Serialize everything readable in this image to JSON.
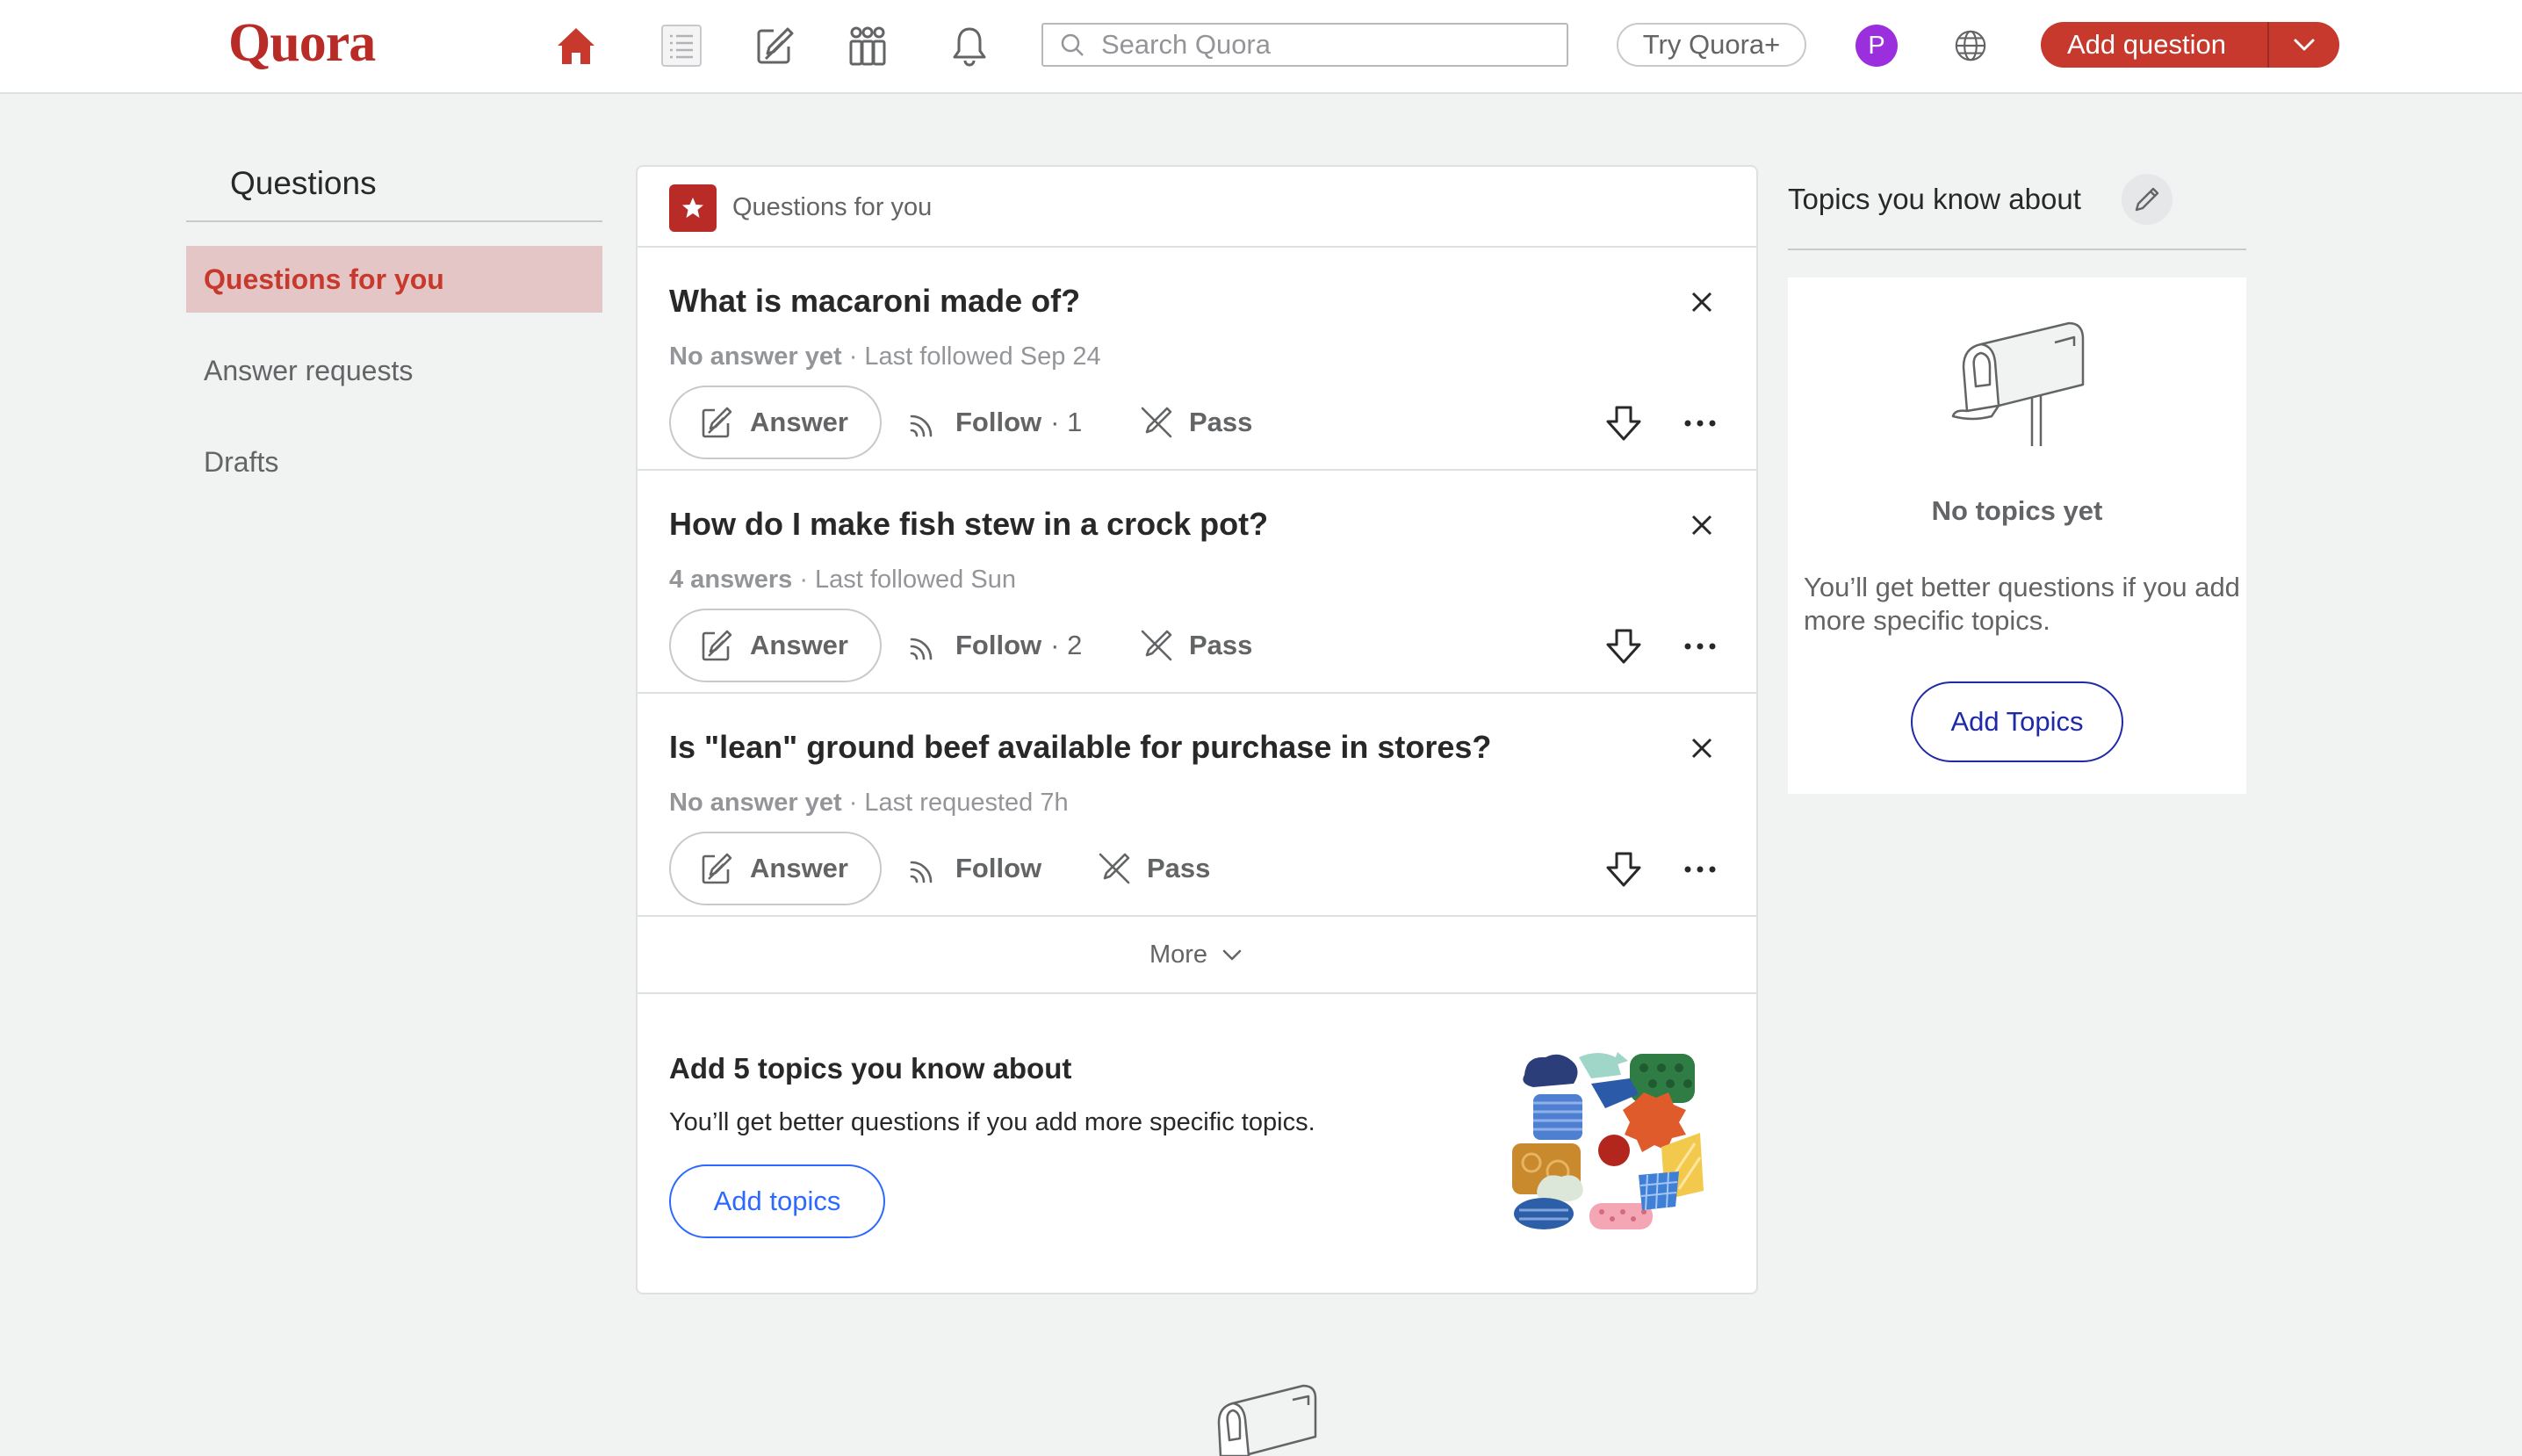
{
  "header": {
    "logo": "Quora",
    "search_placeholder": "Search Quora",
    "try_plus": "Try Quora+",
    "avatar_letter": "P",
    "add_question": "Add question",
    "nav_icons": [
      "home-icon",
      "following-icon",
      "answer-icon",
      "spaces-icon",
      "notifications-icon"
    ]
  },
  "sidebar": {
    "title": "Questions",
    "items": [
      {
        "label": "Questions for you",
        "active": true
      },
      {
        "label": "Answer requests",
        "active": false
      },
      {
        "label": "Drafts",
        "active": false
      }
    ]
  },
  "feed": {
    "header_label": "Questions for you",
    "questions": [
      {
        "title": "What is macaroni made of?",
        "meta_bold": "No answer yet",
        "meta_rest": " · Last followed Sep 24",
        "answer_label": "Answer",
        "follow_label": "Follow",
        "follow_count": "· 1",
        "pass_label": "Pass"
      },
      {
        "title": "How do I make fish stew in a crock pot?",
        "meta_bold": "4 answers",
        "meta_rest": " · Last followed Sun",
        "answer_label": "Answer",
        "follow_label": "Follow",
        "follow_count": "· 2",
        "pass_label": "Pass"
      },
      {
        "title": "Is \"lean\" ground beef available for purchase in stores?",
        "meta_bold": "No answer yet",
        "meta_rest": " · Last requested 7h",
        "answer_label": "Answer",
        "follow_label": "Follow",
        "follow_count": "",
        "pass_label": "Pass"
      }
    ],
    "more_label": "More",
    "promo": {
      "title": "Add 5 topics you know about",
      "text": "You’ll get better questions if you add more specific topics.",
      "button": "Add topics"
    }
  },
  "right_panel": {
    "title": "Topics you know about",
    "empty_title": "No topics yet",
    "empty_text": "You’ll get better questions if you add more specific topics.",
    "button": "Add Topics"
  },
  "colors": {
    "brand": "#b92b27",
    "add_question_bg": "#c7392c",
    "active_sidebar_bg": "#e4c6c6",
    "link_blue": "#2e69ff",
    "dark_blue": "#1f2aa6",
    "avatar": "#9b2fde"
  }
}
